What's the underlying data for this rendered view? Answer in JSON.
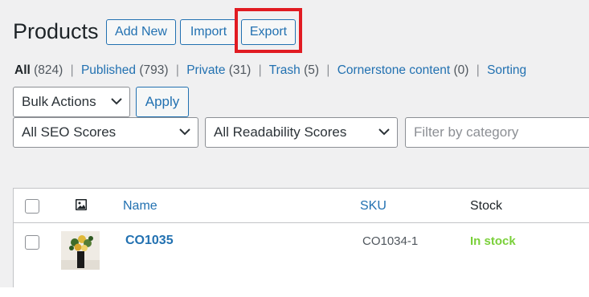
{
  "page": {
    "title": "Products"
  },
  "actions": {
    "add_new": "Add New",
    "import": "Import",
    "export": "Export"
  },
  "views": {
    "all": {
      "label": "All",
      "count": "(824)"
    },
    "published": {
      "label": "Published",
      "count": "(793)"
    },
    "private": {
      "label": "Private",
      "count": "(31)"
    },
    "trash": {
      "label": "Trash",
      "count": "(5)"
    },
    "cornerstone": {
      "label": "Cornerstone content",
      "count": "(0)"
    },
    "sorting": {
      "label": "Sorting"
    },
    "separator": "|"
  },
  "bulk": {
    "selected": "Bulk Actions",
    "apply": "Apply"
  },
  "filters": {
    "seo": "All SEO Scores",
    "readability": "All Readability Scores",
    "category_placeholder": "Filter by category"
  },
  "table": {
    "columns": {
      "name": "Name",
      "sku": "SKU",
      "stock": "Stock"
    },
    "rows": [
      {
        "name": "CO1035",
        "sku": "CO1034-1",
        "stock": "In stock"
      }
    ]
  },
  "colors": {
    "accent": "#2271b1",
    "highlight": "#e11b22",
    "in_stock": "#7ad03a"
  },
  "icons": [
    "image-icon",
    "chevron-down-icon"
  ]
}
